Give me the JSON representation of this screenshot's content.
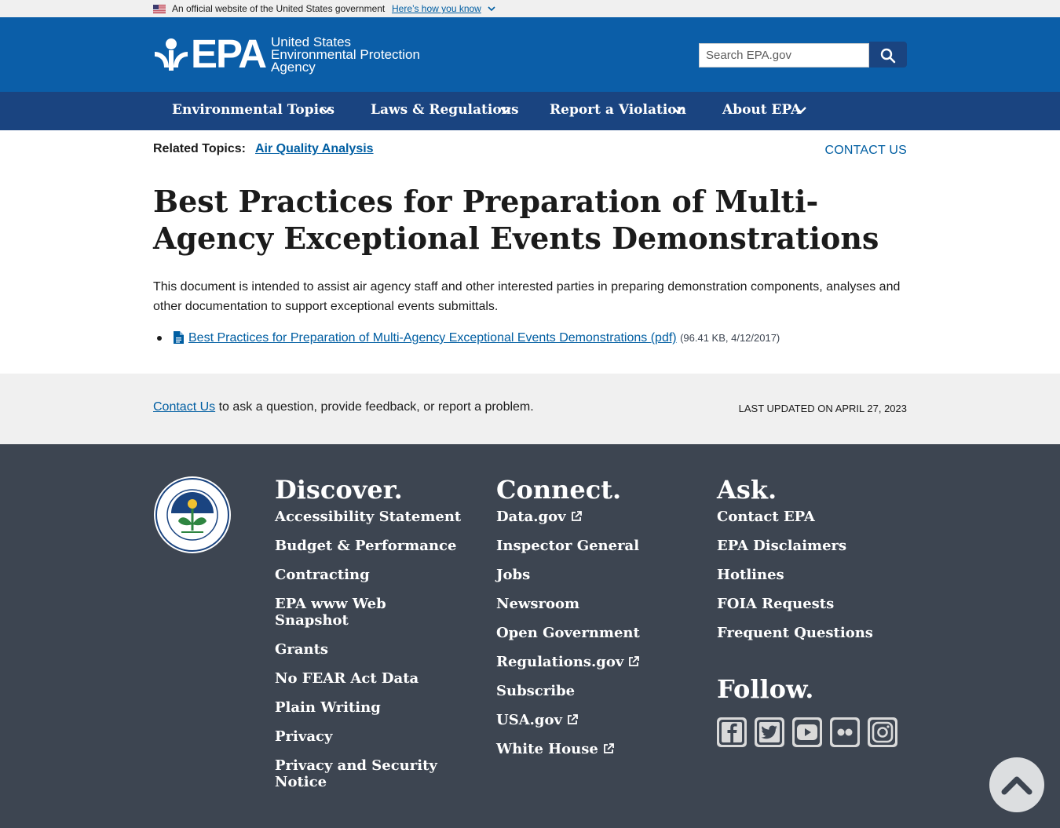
{
  "banner": {
    "official_text": "An official website of the United States government",
    "howto_text": "Here’s how you know"
  },
  "header": {
    "logo_text": "EPA",
    "agency_line1": "United States",
    "agency_line2": "Environmental Protection",
    "agency_line3": "Agency",
    "search_placeholder": "Search EPA.gov",
    "search_icon": "search-icon",
    "brand_color": "#0b5ea8",
    "nav_color": "#1a4480"
  },
  "nav": {
    "items": [
      {
        "label": "Environmental Topics"
      },
      {
        "label": "Laws & Regulations"
      },
      {
        "label": "Report a Violation"
      },
      {
        "label": "About EPA"
      }
    ]
  },
  "related": {
    "label": "Related Topics:",
    "link": "Air Quality Analysis",
    "contact": "CONTACT US"
  },
  "page": {
    "title": "Best Practices for Preparation of Multi-Agency Exceptional Events Demonstrations",
    "intro": "This document is intended to assist air agency staff and other interested parties in preparing demonstration components, analyses and other documentation to support exceptional events submittals.",
    "documents": [
      {
        "link": "Best Practices for Preparation of Multi-Agency Exceptional Events Demonstrations (pdf)",
        "meta": "(96.41 KB, 4/12/2017)"
      }
    ]
  },
  "contact_band": {
    "link": "Contact Us",
    "text": " to ask a question, provide feedback, or report a problem.",
    "updated": "LAST UPDATED ON APRIL 27, 2023"
  },
  "footer": {
    "background": "#3d4551",
    "discover": {
      "heading": "Discover.",
      "links": [
        "Accessibility Statement",
        "Budget & Performance",
        "Contracting",
        "EPA www Web Snapshot",
        "Grants",
        "No FEAR Act Data",
        "Plain Writing",
        "Privacy",
        "Privacy and Security Notice"
      ]
    },
    "connect": {
      "heading": "Connect.",
      "links": [
        {
          "label": "Data.gov",
          "external": true
        },
        {
          "label": "Inspector General",
          "external": false
        },
        {
          "label": "Jobs",
          "external": false
        },
        {
          "label": "Newsroom",
          "external": false
        },
        {
          "label": "Open Government",
          "external": false
        },
        {
          "label": "Regulations.gov",
          "external": true
        },
        {
          "label": "Subscribe",
          "external": false
        },
        {
          "label": "USA.gov",
          "external": true
        },
        {
          "label": "White House",
          "external": true
        }
      ]
    },
    "ask": {
      "heading": "Ask.",
      "links": [
        "Contact EPA",
        "EPA Disclaimers",
        "Hotlines",
        "FOIA Requests",
        "Frequent Questions"
      ]
    },
    "follow": {
      "heading": "Follow.",
      "icons": [
        "facebook-icon",
        "twitter-icon",
        "youtube-icon",
        "flickr-icon",
        "instagram-icon"
      ]
    }
  }
}
